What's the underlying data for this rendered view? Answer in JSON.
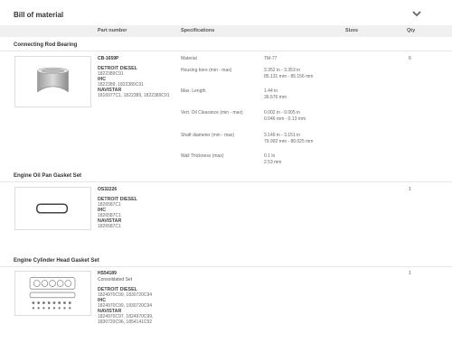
{
  "header": {
    "title": "Bill of material"
  },
  "columns": {
    "part_number": "Part number",
    "specifications": "Specifications",
    "sizes": "Sizes",
    "qty": "Qty"
  },
  "sections": [
    {
      "title": "Connecting Rod Bearing",
      "part_number": "CB-1659P",
      "brands": [
        {
          "name": "DETROIT DIESEL",
          "numbers": "1822389C91"
        },
        {
          "name": "IHC",
          "numbers": "1822389, 1822389C91"
        },
        {
          "name": "NAVISTAR",
          "numbers": "1816977C1, 1822389, 1822389C91"
        }
      ],
      "specs": [
        {
          "key": "Material",
          "value": "TM-77"
        },
        {
          "key": "Housing bore (min - max)",
          "value": "3.352 in - 3.353 in",
          "value2": "85.131 mm - 85.156 mm"
        },
        {
          "key": "Max. Length",
          "value": "1.44 in",
          "value2": "36.576 mm"
        },
        {
          "key": "Vert. Oil Clearance (min - max)",
          "value": "0.002 in - 0.005 in",
          "value2": "0.046 mm - 0.13 mm"
        },
        {
          "key": "Shaft diameter (min - max)",
          "value": "3.149 in - 3.151 in",
          "value2": "79.992 mm - 80.025 mm"
        },
        {
          "key": "Wall Thickness (max)",
          "value": "0.1 in",
          "value2": "2.53 mm"
        }
      ],
      "qty": "6"
    },
    {
      "title": "Engine Oil Pan Gasket Set",
      "part_number": "OS32226",
      "brands": [
        {
          "name": "DETROIT DIESEL",
          "numbers": "1826587C1"
        },
        {
          "name": "IHC",
          "numbers": "1826587C1"
        },
        {
          "name": "NAVISTAR",
          "numbers": "1826587C1"
        }
      ],
      "specs": [],
      "qty": "1"
    },
    {
      "title": "Engine Cylinder Head Gasket Set",
      "part_number": "HS54189",
      "description": "Consolidated Set",
      "brands": [
        {
          "name": "DETROIT DIESEL",
          "numbers": "1824970C99, 1830720C94"
        },
        {
          "name": "IHC",
          "numbers": "1824970C99, 1830720C94"
        },
        {
          "name": "NAVISTAR",
          "numbers": "1824970C97, 1824970C99,",
          "numbers2": "1830720C96, 1854141C92"
        }
      ],
      "specs": [],
      "qty": "1"
    }
  ],
  "icons": {
    "collapse": "chevron-down-icon",
    "bearing": "bearing-image",
    "gasket": "oil-pan-gasket-image",
    "head_gasket": "head-gasket-set-image"
  },
  "colors": {
    "header_bg": "#f0f0f0",
    "divider": "#e6e6e6"
  }
}
